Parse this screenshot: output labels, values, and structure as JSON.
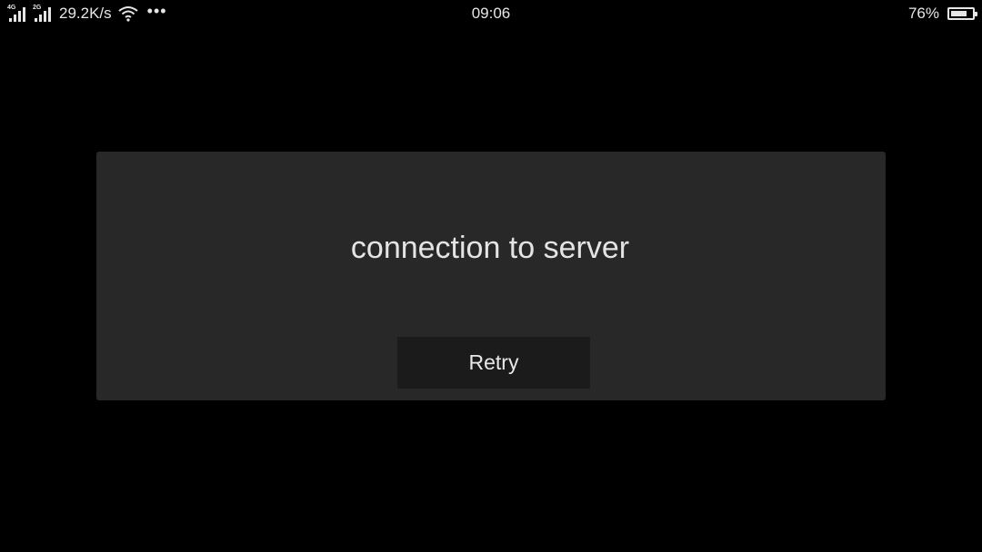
{
  "status_bar": {
    "sim1": {
      "network_tag": "4G",
      "icon": "cellular-signal-icon"
    },
    "sim2": {
      "network_tag": "2G",
      "icon": "cellular-signal-icon"
    },
    "speed": "29.2K/s",
    "wifi_icon": "wifi-icon",
    "more_icon": "more-dots-icon",
    "time": "09:06",
    "battery_percent_text": "76%",
    "battery_level": 0.76
  },
  "dialog": {
    "message": "connection to server",
    "retry_label": "Retry"
  },
  "colors": {
    "background": "#000000",
    "dialog_bg": "#282828",
    "button_bg": "#1b1b1b",
    "text": "#e6e6e6"
  }
}
